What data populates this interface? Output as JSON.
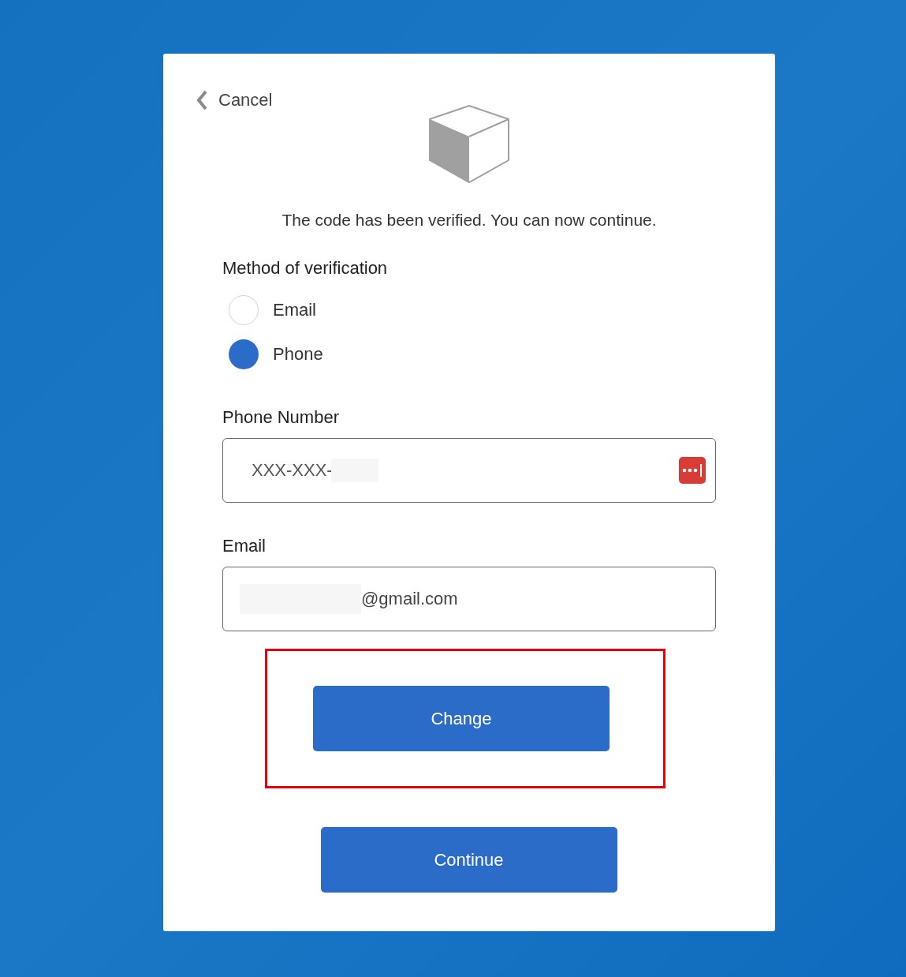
{
  "cancel": "Cancel",
  "message": "The code has been verified. You can now continue.",
  "method": {
    "label": "Method of verification",
    "options": [
      {
        "label": "Email",
        "selected": false
      },
      {
        "label": "Phone",
        "selected": true
      }
    ]
  },
  "phone": {
    "label": "Phone Number",
    "value": "XXX-XXX-"
  },
  "email": {
    "label": "Email",
    "value": "@gmail.com"
  },
  "buttons": [
    "Change",
    "Continue"
  ]
}
